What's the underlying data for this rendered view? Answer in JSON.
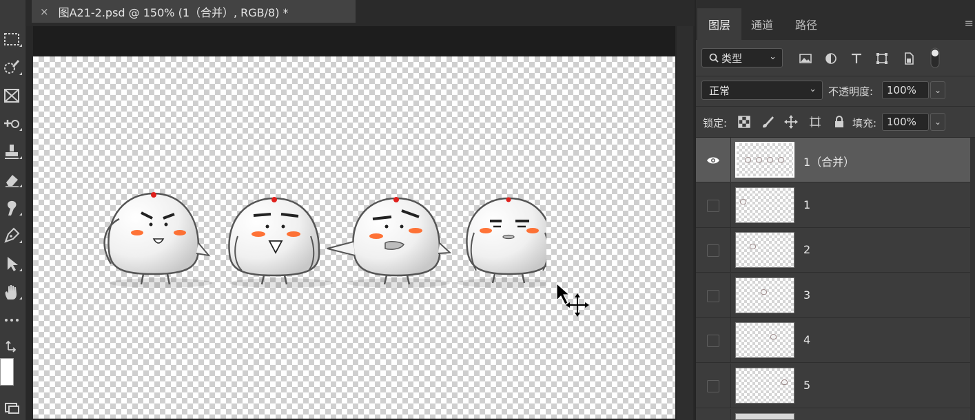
{
  "document_tab": {
    "close_glyph": "×",
    "title": "图A21-2.psd @ 150% (1（合并）, RGB/8) *"
  },
  "toolbar": {
    "tools": [
      "rectangular-marquee-icon",
      "quick-selection-icon",
      "frame-icon",
      "spot-healing-icon",
      "stamp-icon",
      "eraser-icon",
      "smudge-icon",
      "pen-icon",
      "path-selection-icon",
      "hand-icon",
      "more-tools-icon",
      "swap-colors-icon"
    ],
    "foreground_color": "#ffffff"
  },
  "panel": {
    "tabs": [
      {
        "label": "图层",
        "active": true
      },
      {
        "label": "通道",
        "active": false
      },
      {
        "label": "路径",
        "active": false
      }
    ],
    "menu_glyph": "≡",
    "filter": {
      "label": "类型",
      "icons": [
        "image-filter-icon",
        "adjustment-filter-icon",
        "type-filter-icon",
        "shape-filter-icon",
        "smart-object-filter-icon",
        "filter-toggle-icon"
      ]
    },
    "blend_mode": "正常",
    "opacity_label": "不透明度:",
    "opacity_value": "100%",
    "lock_label": "锁定:",
    "lock_icons": [
      "lock-transparent-icon",
      "lock-image-icon",
      "lock-position-icon",
      "lock-artboard-icon",
      "lock-all-icon"
    ],
    "fill_label": "填充:",
    "fill_value": "100%"
  },
  "layers": [
    {
      "name": "1（合并）",
      "visible": true,
      "selected": true
    },
    {
      "name": "1",
      "visible": false,
      "selected": false
    },
    {
      "name": "2",
      "visible": false,
      "selected": false
    },
    {
      "name": "3",
      "visible": false,
      "selected": false
    },
    {
      "name": "4",
      "visible": false,
      "selected": false
    },
    {
      "name": "5",
      "visible": false,
      "selected": false
    }
  ],
  "colors": {
    "accent_red": "#e0201c",
    "cheek_orange": "#ff5a14",
    "ui_bg": "#3c3c3c"
  }
}
